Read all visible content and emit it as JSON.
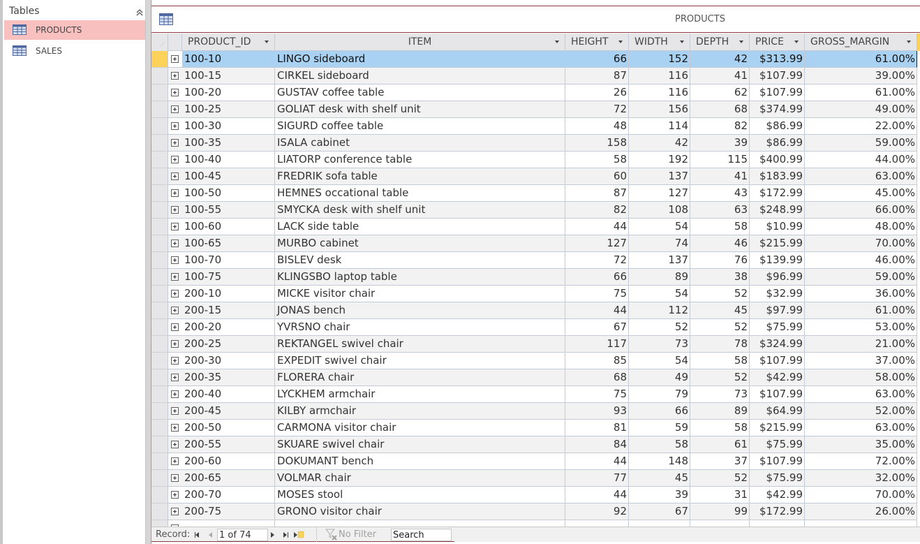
{
  "sidebar": {
    "title": "Tables",
    "items": [
      {
        "label": "PRODUCTS",
        "icon": "table-icon",
        "active": true
      },
      {
        "label": "SALES",
        "icon": "table-icon",
        "active": false
      }
    ]
  },
  "document": {
    "title": "PRODUCTS",
    "icon": "table-icon"
  },
  "grid": {
    "columns": [
      {
        "key": "product_id",
        "label": "PRODUCT_ID"
      },
      {
        "key": "item",
        "label": "ITEM"
      },
      {
        "key": "height",
        "label": "HEIGHT"
      },
      {
        "key": "width",
        "label": "WIDTH"
      },
      {
        "key": "depth",
        "label": "DEPTH"
      },
      {
        "key": "price",
        "label": "PRICE"
      },
      {
        "key": "gross_margin",
        "label": "GROSS_MARGIN"
      }
    ],
    "selected_row": 0,
    "rows": [
      [
        "100-10",
        "LINGO sideboard",
        "66",
        "152",
        "42",
        "$313.99",
        "61.00%"
      ],
      [
        "100-15",
        "CIRKEL sideboard",
        "87",
        "116",
        "41",
        "$107.99",
        "39.00%"
      ],
      [
        "100-20",
        "GUSTAV coffee table",
        "26",
        "116",
        "62",
        "$107.99",
        "61.00%"
      ],
      [
        "100-25",
        "GOLIAT desk with shelf unit",
        "72",
        "156",
        "68",
        "$374.99",
        "49.00%"
      ],
      [
        "100-30",
        "SIGURD coffee table",
        "48",
        "114",
        "82",
        "$86.99",
        "22.00%"
      ],
      [
        "100-35",
        "ISALA cabinet",
        "158",
        "42",
        "39",
        "$86.99",
        "59.00%"
      ],
      [
        "100-40",
        "LIATORP conference table",
        "58",
        "192",
        "115",
        "$400.99",
        "44.00%"
      ],
      [
        "100-45",
        "FREDRIK sofa table",
        "60",
        "137",
        "41",
        "$183.99",
        "63.00%"
      ],
      [
        "100-50",
        "HEMNES occational table",
        "87",
        "127",
        "43",
        "$172.99",
        "45.00%"
      ],
      [
        "100-55",
        "SMYCKA desk with shelf unit",
        "82",
        "108",
        "63",
        "$248.99",
        "66.00%"
      ],
      [
        "100-60",
        "LACK side table",
        "44",
        "54",
        "58",
        "$10.99",
        "48.00%"
      ],
      [
        "100-65",
        "MURBO cabinet",
        "127",
        "74",
        "46",
        "$215.99",
        "70.00%"
      ],
      [
        "100-70",
        "BISLEV desk",
        "72",
        "137",
        "76",
        "$139.99",
        "46.00%"
      ],
      [
        "100-75",
        "KLINGSBO laptop table",
        "66",
        "89",
        "38",
        "$96.99",
        "59.00%"
      ],
      [
        "200-10",
        "MICKE visitor chair",
        "75",
        "54",
        "52",
        "$32.99",
        "36.00%"
      ],
      [
        "200-15",
        "JONAS bench",
        "44",
        "112",
        "45",
        "$97.99",
        "61.00%"
      ],
      [
        "200-20",
        "YVRSNO chair",
        "67",
        "52",
        "52",
        "$75.99",
        "53.00%"
      ],
      [
        "200-25",
        "REKTANGEL swivel chair",
        "117",
        "73",
        "78",
        "$324.99",
        "21.00%"
      ],
      [
        "200-30",
        "EXPEDIT swivel chair",
        "85",
        "54",
        "58",
        "$107.99",
        "37.00%"
      ],
      [
        "200-35",
        "FLORERA chair",
        "68",
        "49",
        "52",
        "$42.99",
        "58.00%"
      ],
      [
        "200-40",
        "LYCKHEM armchair",
        "75",
        "79",
        "73",
        "$107.99",
        "63.00%"
      ],
      [
        "200-45",
        "KILBY armchair",
        "93",
        "66",
        "89",
        "$64.99",
        "52.00%"
      ],
      [
        "200-50",
        "CARMONA visitor chair",
        "81",
        "59",
        "58",
        "$215.99",
        "63.00%"
      ],
      [
        "200-55",
        "SKUARE swivel chair",
        "84",
        "58",
        "61",
        "$75.99",
        "35.00%"
      ],
      [
        "200-60",
        "DOKUMANT bench",
        "44",
        "148",
        "37",
        "$107.99",
        "72.00%"
      ],
      [
        "200-65",
        "VOLMAR chair",
        "77",
        "45",
        "52",
        "$75.99",
        "32.00%"
      ],
      [
        "200-70",
        "MOSES stool",
        "44",
        "39",
        "31",
        "$42.99",
        "70.00%"
      ],
      [
        "200-75",
        "GRONO visitor chair",
        "92",
        "67",
        "99",
        "$172.99",
        "26.00%"
      ]
    ]
  },
  "record_nav": {
    "label": "Record:",
    "position": "1 of 74",
    "filter_label": "No Filter",
    "search_placeholder": "Search"
  },
  "colors": {
    "selected_row": "#a9d1f2",
    "active_nav_item": "#f9c0c0",
    "current_record_marker": "#fcd25a",
    "document_border": "#8b3a46"
  }
}
